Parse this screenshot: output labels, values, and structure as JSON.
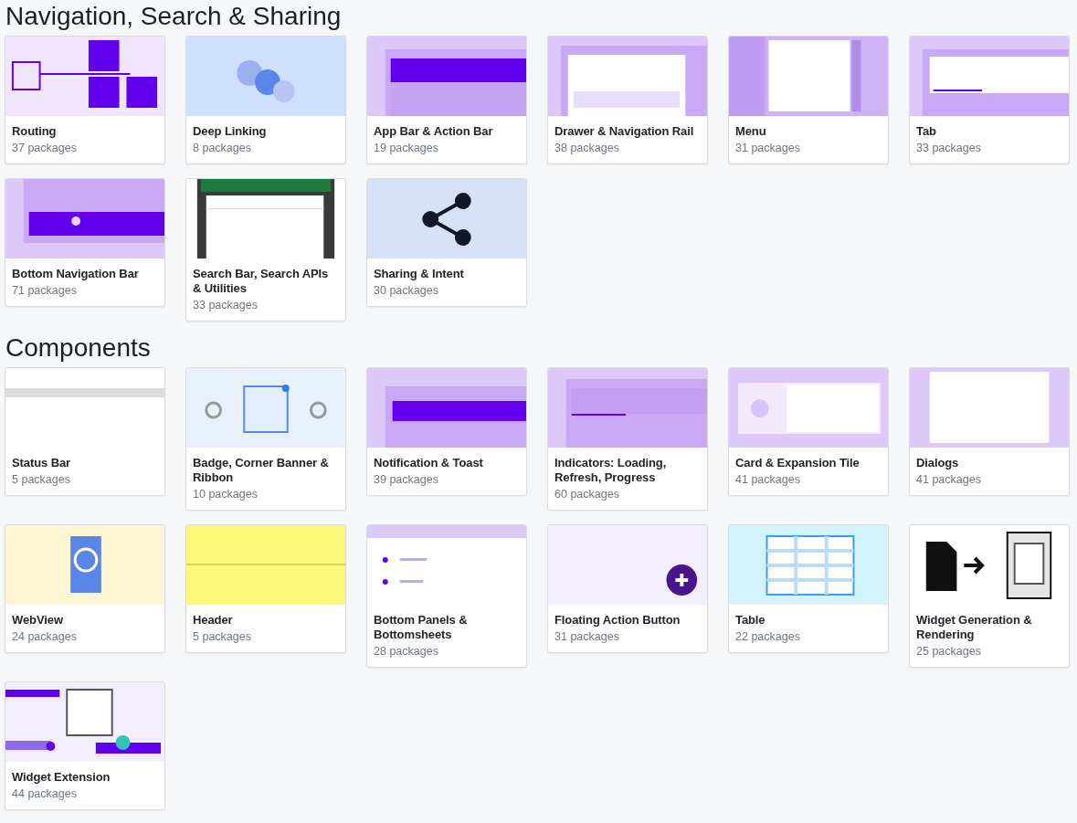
{
  "sections": [
    {
      "title": "Navigation, Search & Sharing",
      "cards": [
        {
          "kind": "picture",
          "name": "Routing",
          "count": "37 packages"
        },
        {
          "kind": "picture",
          "name": "Deep Linking",
          "count": "8 packages"
        },
        {
          "kind": "picture",
          "name": "App Bar & Action Bar",
          "count": "19 packages"
        },
        {
          "kind": "picture",
          "name": "Drawer & Navigation Rail",
          "count": "38 packages"
        },
        {
          "kind": "picture",
          "name": "Menu",
          "count": "31 packages"
        },
        {
          "kind": "picture",
          "name": "Tab",
          "count": "33 packages"
        },
        {
          "kind": "picture",
          "name": "Bottom Navigation Bar",
          "count": "71 packages"
        },
        {
          "kind": "picture",
          "name": "Search Bar, Search APIs & Utilities",
          "count": "33 packages"
        },
        {
          "kind": "picture",
          "name": "Sharing & Intent",
          "count": "30 packages"
        }
      ]
    },
    {
      "title": "Components",
      "cards": [
        {
          "kind": "picture",
          "name": "Status Bar",
          "count": "5 packages"
        },
        {
          "kind": "picture",
          "name": "Badge, Corner Banner & Ribbon",
          "count": "10 packages"
        },
        {
          "kind": "picture",
          "name": "Notification & Toast",
          "count": "39 packages"
        },
        {
          "kind": "picture",
          "name": "Indicators: Loading, Refresh, Progress",
          "count": "60 packages"
        },
        {
          "kind": "picture",
          "name": "Card & Expansion Tile",
          "count": "41 packages"
        },
        {
          "kind": "picture",
          "name": "Dialogs",
          "count": "41 packages"
        },
        {
          "kind": "picture",
          "name": "WebView",
          "count": "24 packages"
        },
        {
          "kind": "picture",
          "name": "Header",
          "count": "5 packages"
        },
        {
          "kind": "picture",
          "name": "Bottom Panels & Bottomsheets",
          "count": "28 packages"
        },
        {
          "kind": "picture",
          "name": "Floating Action Button",
          "count": "31 packages"
        },
        {
          "kind": "picture",
          "name": "Table",
          "count": "22 packages"
        },
        {
          "kind": "picture",
          "name": "Widget Generation & Rendering",
          "count": "25 packages"
        },
        {
          "kind": "picture",
          "name": "Widget Extension",
          "count": "44 packages"
        }
      ]
    }
  ]
}
